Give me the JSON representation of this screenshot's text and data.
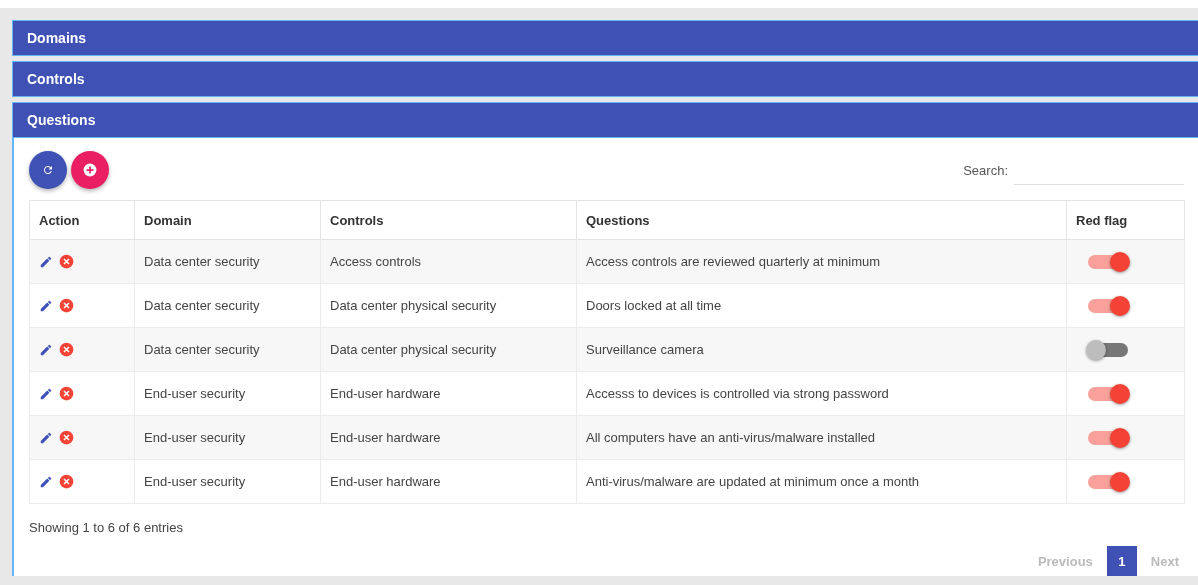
{
  "panels": [
    {
      "title": "Domains",
      "expanded": false
    },
    {
      "title": "Controls",
      "expanded": false
    },
    {
      "title": "Questions",
      "expanded": true
    }
  ],
  "search": {
    "label": "Search:"
  },
  "table": {
    "columns": [
      "Action",
      "Domain",
      "Controls",
      "Questions",
      "Red flag"
    ],
    "rows": [
      {
        "domain": "Data center security",
        "control": "Access controls",
        "question": "Access controls are reviewed quarterly at minimum",
        "red_flag": true
      },
      {
        "domain": "Data center security",
        "control": "Data center physical security",
        "question": "Doors locked at all time",
        "red_flag": true
      },
      {
        "domain": "Data center security",
        "control": "Data center physical security",
        "question": "Surveillance camera",
        "red_flag": false
      },
      {
        "domain": "End-user security",
        "control": "End-user hardware",
        "question": "Accesss to devices is controlled via strong password",
        "red_flag": true
      },
      {
        "domain": "End-user security",
        "control": "End-user hardware",
        "question": "All computers have an anti-virus/malware installed",
        "red_flag": true
      },
      {
        "domain": "End-user security",
        "control": "End-user hardware",
        "question": "Anti-virus/malware are updated at minimum once a month",
        "red_flag": true
      }
    ]
  },
  "info": "Showing 1 to 6 of 6 entries",
  "pagination": {
    "previous": "Previous",
    "pages": [
      {
        "label": "1",
        "selected": true
      }
    ],
    "next": "Next"
  }
}
